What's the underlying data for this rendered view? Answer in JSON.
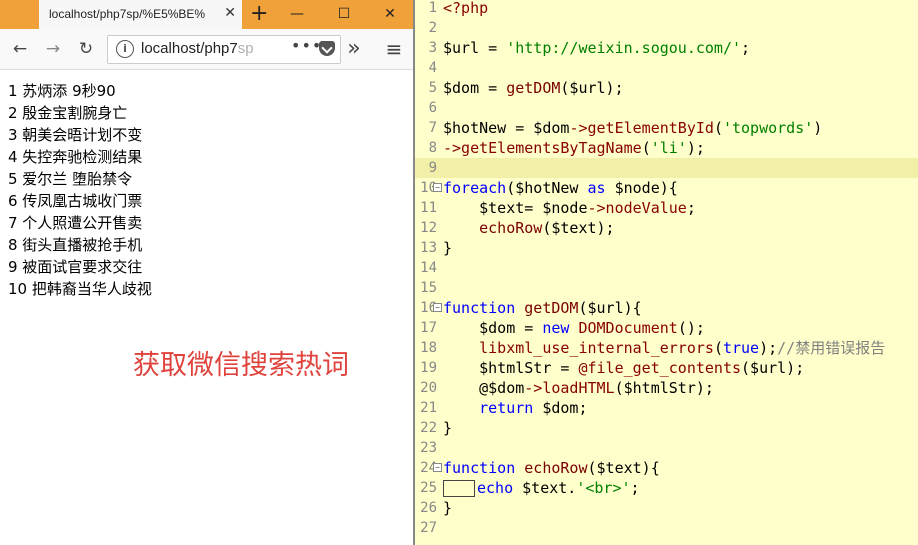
{
  "browser": {
    "tab_title": "localhost/php7sp/%E5%BE%",
    "tab_close": "✕",
    "new_tab": "+",
    "window_minimize": "—",
    "window_maximize": "☐",
    "window_close": "✕",
    "url_host": "localhost/php7",
    "url_rest": "sp",
    "nav_back": "←",
    "nav_forward": "→",
    "nav_reload": "↻",
    "overflow": "»",
    "menu": "≡",
    "more_dots": "•••"
  },
  "results": [
    "1 苏炳添 9秒90",
    "2 殷金宝割腕身亡",
    "3 朝美会晤计划不变",
    "4 失控奔驰检测结果",
    "5 爱尔兰 堕胎禁令",
    "6 传凤凰古城收门票",
    "7 个人照遭公开售卖",
    "8 街头直播被抢手机",
    "9 被面试官要求交往",
    "10 把韩裔当华人歧视"
  ],
  "overlay_label": "获取微信搜索热词",
  "editor": {
    "highlight_line": 9,
    "lines": [
      {
        "n": "1",
        "t": "<?php"
      },
      {
        "n": "2",
        "t": ""
      },
      {
        "n": "3",
        "t": "$url = 'http://weixin.sogou.com/';"
      },
      {
        "n": "4",
        "t": ""
      },
      {
        "n": "5",
        "t": "$dom = getDOM($url);"
      },
      {
        "n": "6",
        "t": ""
      },
      {
        "n": "7",
        "t": "$hotNew = $dom->getElementById('topwords')"
      },
      {
        "n": "8",
        "t": "->getElementsByTagName('li');"
      },
      {
        "n": "9",
        "t": ""
      },
      {
        "n": "10",
        "t": "foreach($hotNew as $node){"
      },
      {
        "n": "11",
        "t": "    $text= $node->nodeValue;"
      },
      {
        "n": "12",
        "t": "    echoRow($text);"
      },
      {
        "n": "13",
        "t": "}"
      },
      {
        "n": "14",
        "t": ""
      },
      {
        "n": "15",
        "t": ""
      },
      {
        "n": "16",
        "t": "function getDOM($url){"
      },
      {
        "n": "17",
        "t": "    $dom = new DOMDocument();"
      },
      {
        "n": "18",
        "t": "    libxml_use_internal_errors(true);//禁用错误报告"
      },
      {
        "n": "19",
        "t": "    $htmlStr = @file_get_contents($url);"
      },
      {
        "n": "20",
        "t": "    @$dom->loadHTML($htmlStr);"
      },
      {
        "n": "21",
        "t": "    return $dom;"
      },
      {
        "n": "22",
        "t": "}"
      },
      {
        "n": "23",
        "t": ""
      },
      {
        "n": "24",
        "t": "function echoRow($text){"
      },
      {
        "n": "25",
        "t": "    echo $text.'<br>';"
      },
      {
        "n": "26",
        "t": "}"
      },
      {
        "n": "27",
        "t": ""
      }
    ]
  }
}
